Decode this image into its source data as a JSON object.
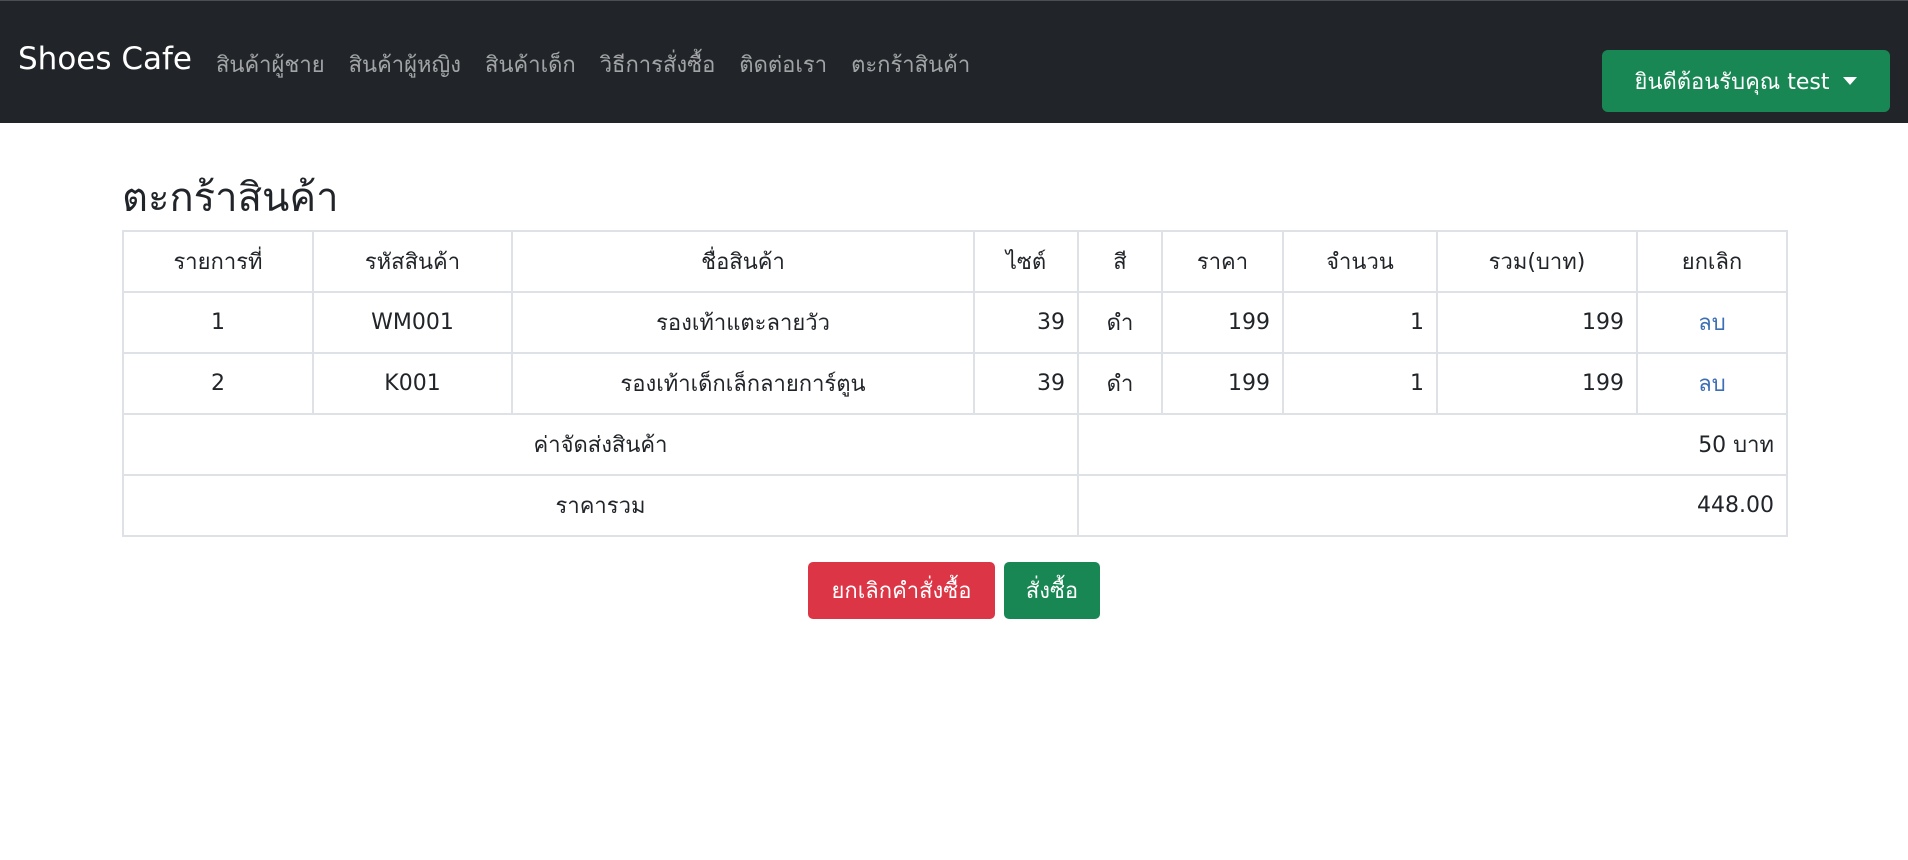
{
  "navbar": {
    "brand": "Shoes Cafe",
    "links": [
      "สินค้าผู้ชาย",
      "สินค้าผู้หญิง",
      "สินค้าเด็ก",
      "วิธีการสั่งซื้อ",
      "ติดต่อเรา",
      "ตะกร้าสินค้า"
    ],
    "user_label": "ยินดีต้อนรับคุณ test"
  },
  "page": {
    "title": "ตะกร้าสินค้า"
  },
  "table": {
    "headers": [
      "รายการที่",
      "รหัสสินค้า",
      "ชื่อสินค้า",
      "ไซต์",
      "สี",
      "ราคา",
      "จำนวน",
      "รวม(บาท)",
      "ยกเลิก"
    ],
    "rows": [
      {
        "no": "1",
        "code": "WM001",
        "name": "รองเท้าแตะลายวัว",
        "size": "39",
        "color": "ดำ",
        "price": "199",
        "qty": "1",
        "total": "199",
        "action": "ลบ"
      },
      {
        "no": "2",
        "code": "K001",
        "name": "รองเท้าเด็กเล็กลายการ์ตูน",
        "size": "39",
        "color": "ดำ",
        "price": "199",
        "qty": "1",
        "total": "199",
        "action": "ลบ"
      }
    ],
    "shipping_label": "ค่าจัดส่งสินค้า",
    "shipping_value": "50 บาท",
    "total_label": "ราคารวม",
    "total_value": "448.00"
  },
  "actions": {
    "cancel_label": "ยกเลิกคำสั่งซื้อ",
    "order_label": "สั่งซื้อ"
  },
  "colors": {
    "navbar_bg": "#212529",
    "success": "#198754",
    "danger": "#dc3545",
    "link": "#3d6fb5"
  }
}
